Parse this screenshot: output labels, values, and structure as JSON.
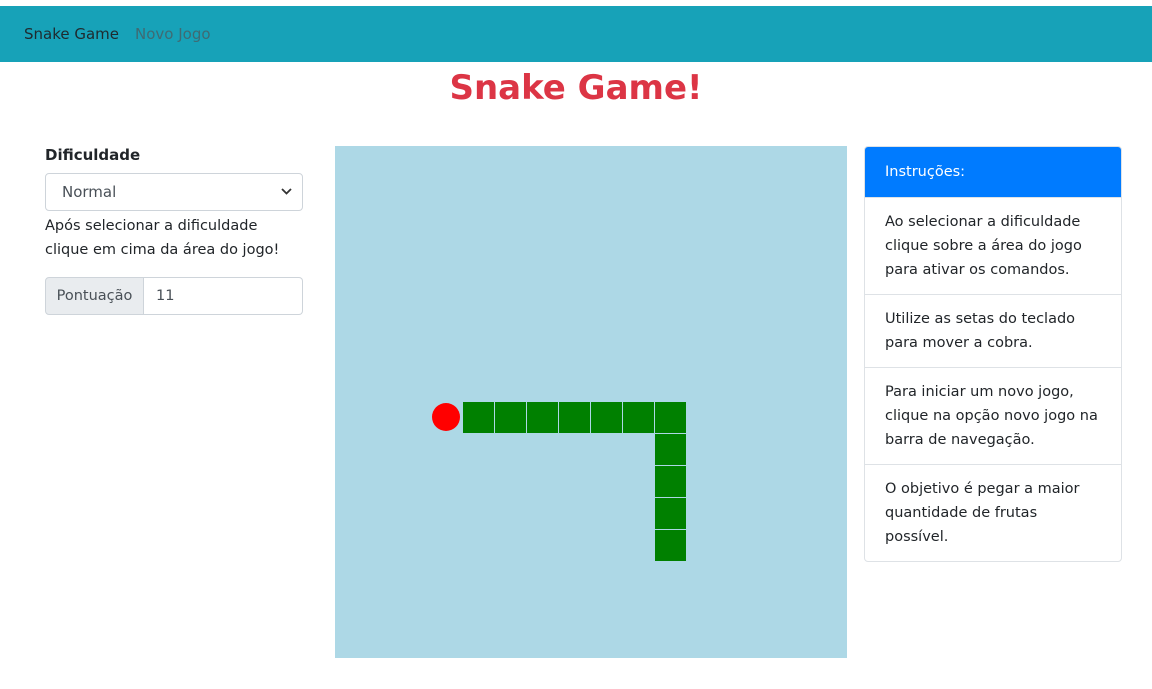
{
  "navbar": {
    "brand": "Snake Game",
    "new_game": "Novo Jogo"
  },
  "title": "Snake Game!",
  "left_panel": {
    "difficulty_label": "Dificuldade",
    "difficulty_selected": "Normal",
    "help_text": "Após selecionar a dificuldade clique em cima da área do jogo!",
    "score_label": "Pontuação",
    "score_value": "11"
  },
  "game": {
    "board_color": "#add8e6",
    "snake_color": "#008000",
    "fruit_color": "#ff0000",
    "grid_size": 16,
    "fruit": [
      3,
      8
    ],
    "snake": [
      [
        4,
        8
      ],
      [
        5,
        8
      ],
      [
        6,
        8
      ],
      [
        7,
        8
      ],
      [
        8,
        8
      ],
      [
        9,
        8
      ],
      [
        10,
        8
      ],
      [
        10,
        9
      ],
      [
        10,
        10
      ],
      [
        10,
        11
      ],
      [
        10,
        12
      ]
    ]
  },
  "instructions": {
    "header": "Instruções:",
    "items": [
      "Ao selecionar a dificuldade clique sobre a área do jogo para ativar os comandos.",
      "Utilize as setas do teclado para mover a cobra.",
      "Para iniciar um novo jogo, clique na opção novo jogo na barra de navegação.",
      "O objetivo é pegar a maior quantidade de frutas possível."
    ]
  },
  "colors": {
    "navbar": "#17a2b8",
    "title": "#dc3545",
    "instructions_header": "#007bff"
  }
}
